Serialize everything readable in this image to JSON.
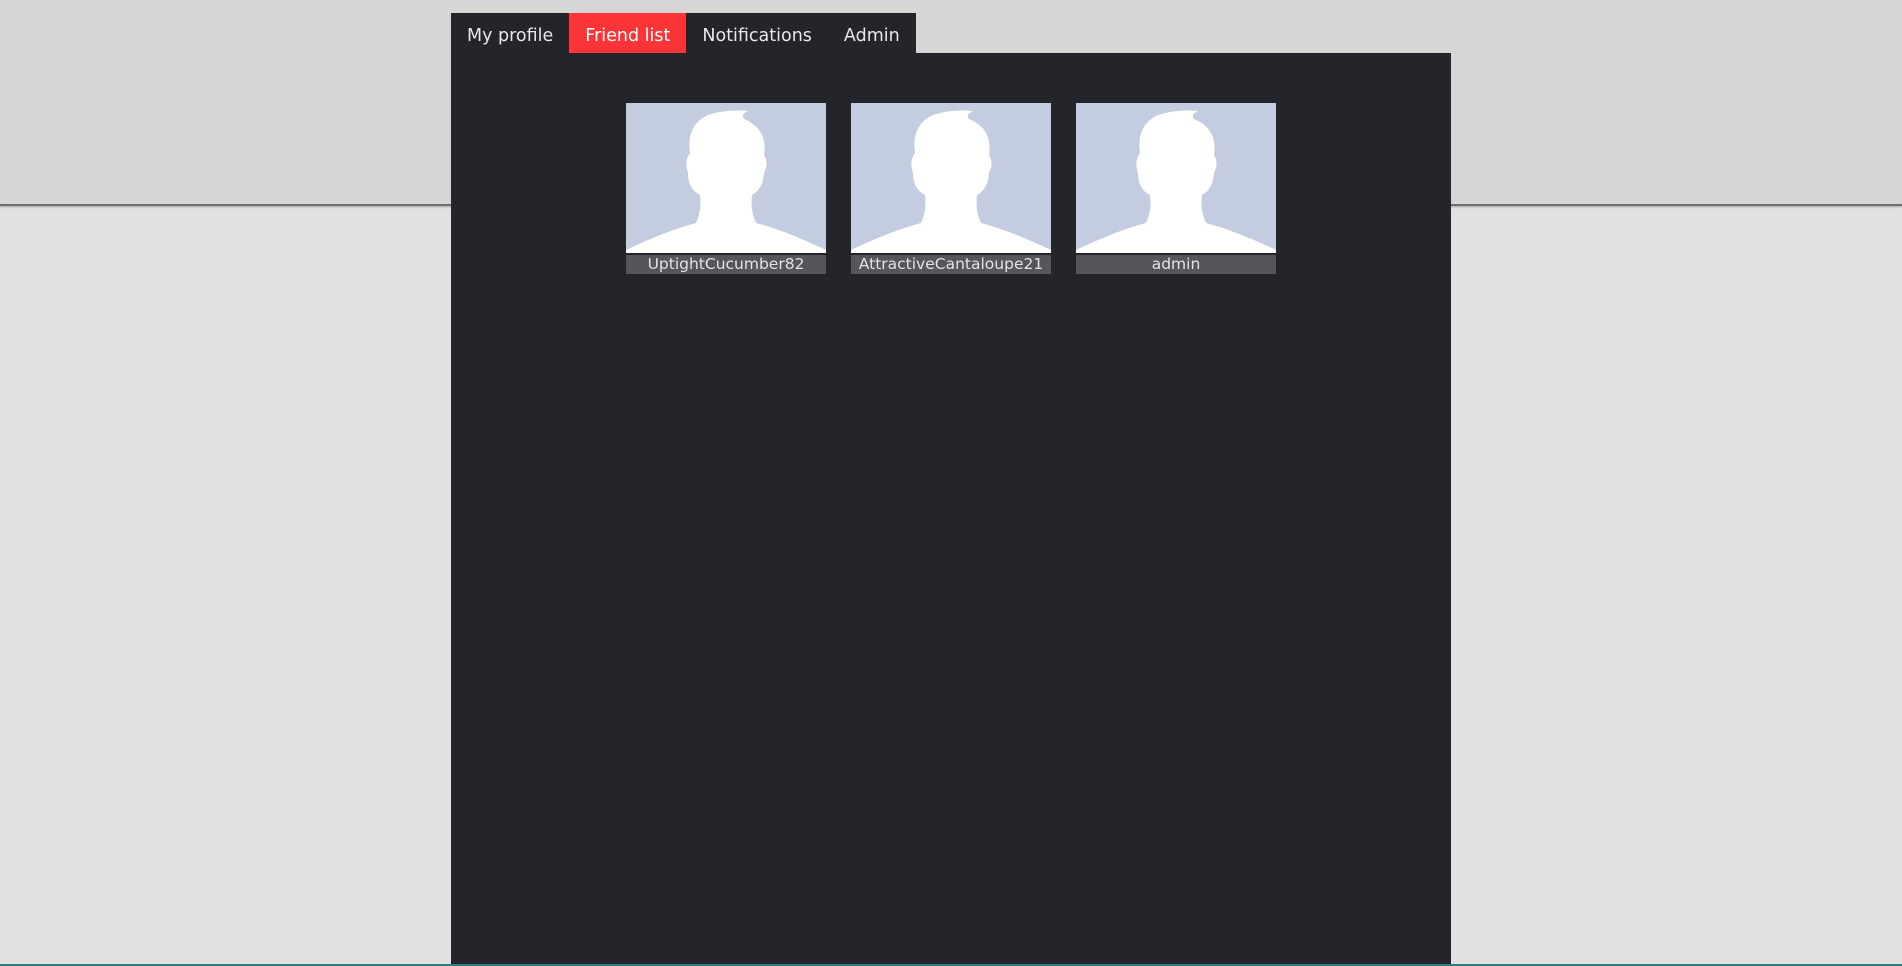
{
  "nav": {
    "tabs": [
      {
        "label": "My profile",
        "active": false
      },
      {
        "label": "Friend list",
        "active": true
      },
      {
        "label": "Notifications",
        "active": false
      },
      {
        "label": "Admin",
        "active": false
      }
    ]
  },
  "friends": [
    {
      "name": "UptightCucumber82",
      "avatar_icon": "default-person-silhouette-icon"
    },
    {
      "name": "AttractiveCantaloupe21",
      "avatar_icon": "default-person-silhouette-icon"
    },
    {
      "name": "admin",
      "avatar_icon": "default-person-silhouette-icon"
    }
  ],
  "colors": {
    "page_background": "#e1e1e1",
    "header_band": "#d6d6d6",
    "panel_background": "#24252a",
    "active_tab": "#fb3537",
    "avatar_background": "#c3cddf",
    "name_bar": "#55565b"
  }
}
